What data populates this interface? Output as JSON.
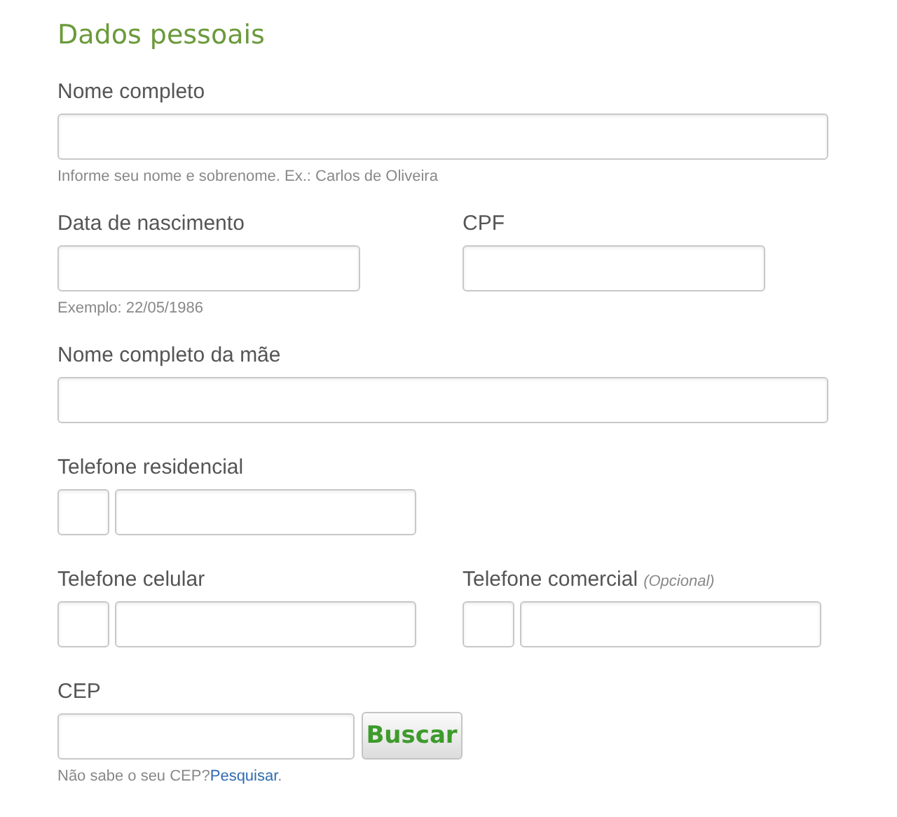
{
  "title": "Dados pessoais",
  "rows": [
    {
      "fields": [
        {
          "kind": "wide",
          "label": "Nome completo",
          "help": "Informe seu nome e sobrenome. Ex.: Carlos de Oliveira"
        }
      ]
    },
    {
      "fields": [
        {
          "kind": "text",
          "label": "Data de nascimento",
          "help": "Exemplo: 22/05/1986"
        },
        {
          "kind": "text",
          "label": "CPF"
        }
      ]
    },
    {
      "fields": [
        {
          "kind": "wide",
          "label": "Nome completo da mãe"
        }
      ]
    },
    {
      "fields": [
        {
          "kind": "phone",
          "label": "Telefone residencial"
        }
      ]
    },
    {
      "fields": [
        {
          "kind": "phone",
          "label": "Telefone celular"
        },
        {
          "kind": "phone",
          "label": "Telefone comercial",
          "optional": "(Opcional)"
        }
      ]
    },
    {
      "fields": [
        {
          "kind": "cep",
          "label": "CEP",
          "button": "Buscar",
          "help": "Não sabe o seu CEP?",
          "link": "Pesquisar",
          "help_end": "."
        }
      ]
    }
  ]
}
